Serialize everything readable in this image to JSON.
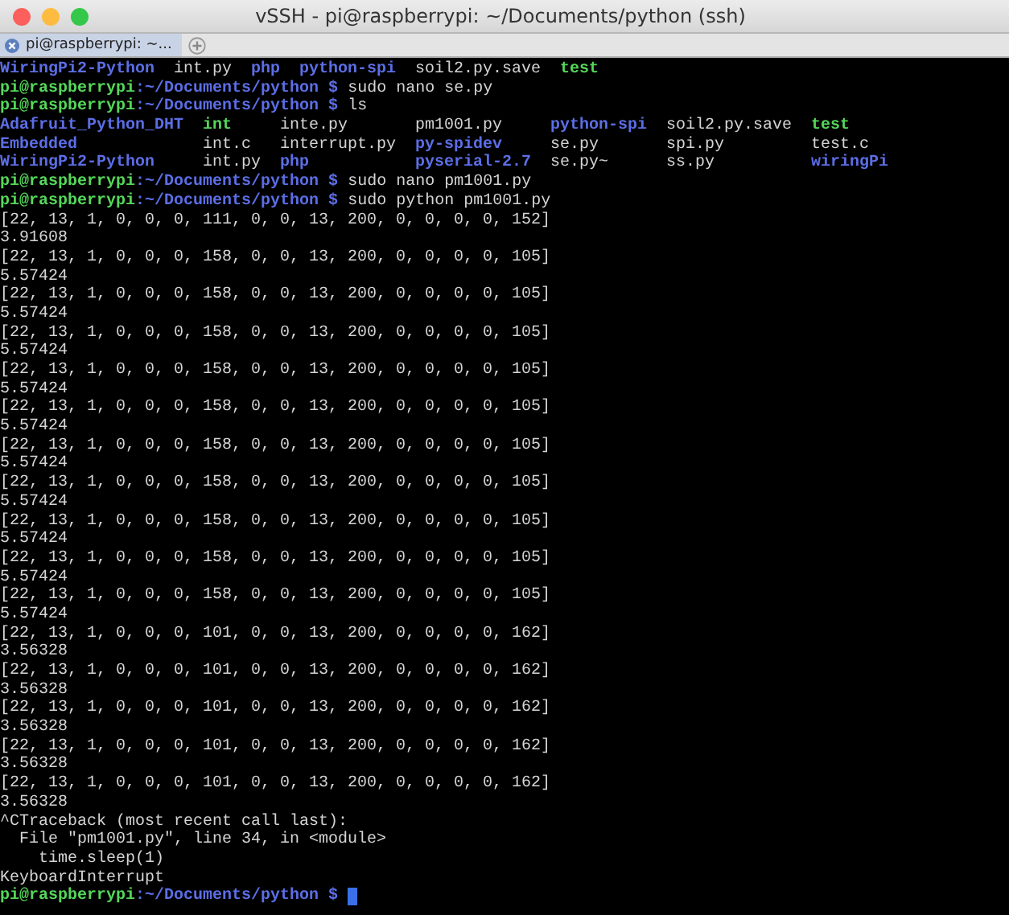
{
  "window": {
    "title": "vSSH - pi@raspberrypi: ~/Documents/python (ssh)"
  },
  "tab": {
    "label": "pi@raspberrypi: ~..."
  },
  "terminal": {
    "lines": [
      {
        "kind": "listing",
        "cells": [
          {
            "text": "WiringPi2-Python",
            "kind": "dir"
          },
          {
            "text": "int.py",
            "kind": "file"
          },
          {
            "text": "php",
            "kind": "dir"
          },
          {
            "text": "python-spi",
            "kind": "dir"
          },
          {
            "text": "soil2.py.save",
            "kind": "file"
          },
          {
            "text": "test",
            "kind": "exec"
          }
        ]
      },
      {
        "kind": "prompt",
        "user": "pi@raspberrypi",
        "separator": ":",
        "path": "~/Documents/python $",
        "command": "sudo nano se.py"
      },
      {
        "kind": "prompt",
        "user": "pi@raspberrypi",
        "separator": ":",
        "path": "~/Documents/python $",
        "command": "ls"
      },
      {
        "kind": "listing",
        "cells": [
          {
            "text": "Adafruit_Python_DHT",
            "kind": "dir"
          },
          {
            "text": "int",
            "kind": "exec"
          },
          {
            "text": "inte.py",
            "kind": "file"
          },
          {
            "text": "pm1001.py",
            "kind": "file"
          },
          {
            "text": "python-spi",
            "kind": "dir"
          },
          {
            "text": "soil2.py.save",
            "kind": "file"
          },
          {
            "text": "test",
            "kind": "exec"
          }
        ]
      },
      {
        "kind": "listing",
        "cells": [
          {
            "text": "Embedded",
            "kind": "dir"
          },
          {
            "text": "int.c",
            "kind": "file"
          },
          {
            "text": "interrupt.py",
            "kind": "file"
          },
          {
            "text": "py-spidev",
            "kind": "dir"
          },
          {
            "text": "se.py",
            "kind": "file"
          },
          {
            "text": "spi.py",
            "kind": "file"
          },
          {
            "text": "test.c",
            "kind": "file"
          }
        ]
      },
      {
        "kind": "listing",
        "cells": [
          {
            "text": "WiringPi2-Python",
            "kind": "dir"
          },
          {
            "text": "int.py",
            "kind": "file"
          },
          {
            "text": "php",
            "kind": "dir"
          },
          {
            "text": "pyserial-2.7",
            "kind": "dir"
          },
          {
            "text": "se.py~",
            "kind": "file"
          },
          {
            "text": "ss.py",
            "kind": "file"
          },
          {
            "text": "wiringPi",
            "kind": "dir"
          }
        ]
      },
      {
        "kind": "prompt",
        "user": "pi@raspberrypi",
        "separator": ":",
        "path": "~/Documents/python $",
        "command": "sudo nano pm1001.py"
      },
      {
        "kind": "prompt",
        "user": "pi@raspberrypi",
        "separator": ":",
        "path": "~/Documents/python $",
        "command": "sudo python pm1001.py"
      },
      {
        "kind": "output",
        "text": "[22, 13, 1, 0, 0, 0, 111, 0, 0, 13, 200, 0, 0, 0, 0, 152]"
      },
      {
        "kind": "output",
        "text": "3.91608"
      },
      {
        "kind": "output",
        "text": "[22, 13, 1, 0, 0, 0, 158, 0, 0, 13, 200, 0, 0, 0, 0, 105]"
      },
      {
        "kind": "output",
        "text": "5.57424"
      },
      {
        "kind": "output",
        "text": "[22, 13, 1, 0, 0, 0, 158, 0, 0, 13, 200, 0, 0, 0, 0, 105]"
      },
      {
        "kind": "output",
        "text": "5.57424"
      },
      {
        "kind": "output",
        "text": "[22, 13, 1, 0, 0, 0, 158, 0, 0, 13, 200, 0, 0, 0, 0, 105]"
      },
      {
        "kind": "output",
        "text": "5.57424"
      },
      {
        "kind": "output",
        "text": "[22, 13, 1, 0, 0, 0, 158, 0, 0, 13, 200, 0, 0, 0, 0, 105]"
      },
      {
        "kind": "output",
        "text": "5.57424"
      },
      {
        "kind": "output",
        "text": "[22, 13, 1, 0, 0, 0, 158, 0, 0, 13, 200, 0, 0, 0, 0, 105]"
      },
      {
        "kind": "output",
        "text": "5.57424"
      },
      {
        "kind": "output",
        "text": "[22, 13, 1, 0, 0, 0, 158, 0, 0, 13, 200, 0, 0, 0, 0, 105]"
      },
      {
        "kind": "output",
        "text": "5.57424"
      },
      {
        "kind": "output",
        "text": "[22, 13, 1, 0, 0, 0, 158, 0, 0, 13, 200, 0, 0, 0, 0, 105]"
      },
      {
        "kind": "output",
        "text": "5.57424"
      },
      {
        "kind": "output",
        "text": "[22, 13, 1, 0, 0, 0, 158, 0, 0, 13, 200, 0, 0, 0, 0, 105]"
      },
      {
        "kind": "output",
        "text": "5.57424"
      },
      {
        "kind": "output",
        "text": "[22, 13, 1, 0, 0, 0, 158, 0, 0, 13, 200, 0, 0, 0, 0, 105]"
      },
      {
        "kind": "output",
        "text": "5.57424"
      },
      {
        "kind": "output",
        "text": "[22, 13, 1, 0, 0, 0, 158, 0, 0, 13, 200, 0, 0, 0, 0, 105]"
      },
      {
        "kind": "output",
        "text": "5.57424"
      },
      {
        "kind": "output",
        "text": "[22, 13, 1, 0, 0, 0, 101, 0, 0, 13, 200, 0, 0, 0, 0, 162]"
      },
      {
        "kind": "output",
        "text": "3.56328"
      },
      {
        "kind": "output",
        "text": "[22, 13, 1, 0, 0, 0, 101, 0, 0, 13, 200, 0, 0, 0, 0, 162]"
      },
      {
        "kind": "output",
        "text": "3.56328"
      },
      {
        "kind": "output",
        "text": "[22, 13, 1, 0, 0, 0, 101, 0, 0, 13, 200, 0, 0, 0, 0, 162]"
      },
      {
        "kind": "output",
        "text": "3.56328"
      },
      {
        "kind": "output",
        "text": "[22, 13, 1, 0, 0, 0, 101, 0, 0, 13, 200, 0, 0, 0, 0, 162]"
      },
      {
        "kind": "output",
        "text": "3.56328"
      },
      {
        "kind": "output",
        "text": "[22, 13, 1, 0, 0, 0, 101, 0, 0, 13, 200, 0, 0, 0, 0, 162]"
      },
      {
        "kind": "output",
        "text": "3.56328"
      },
      {
        "kind": "output",
        "text": "^CTraceback (most recent call last):"
      },
      {
        "kind": "output",
        "text": "  File \"pm1001.py\", line 34, in <module>"
      },
      {
        "kind": "output",
        "text": "    time.sleep(1)"
      },
      {
        "kind": "output",
        "text": "KeyboardInterrupt"
      },
      {
        "kind": "prompt",
        "user": "pi@raspberrypi",
        "separator": ":",
        "path": "~/Documents/python $",
        "cursor": true
      }
    ]
  }
}
